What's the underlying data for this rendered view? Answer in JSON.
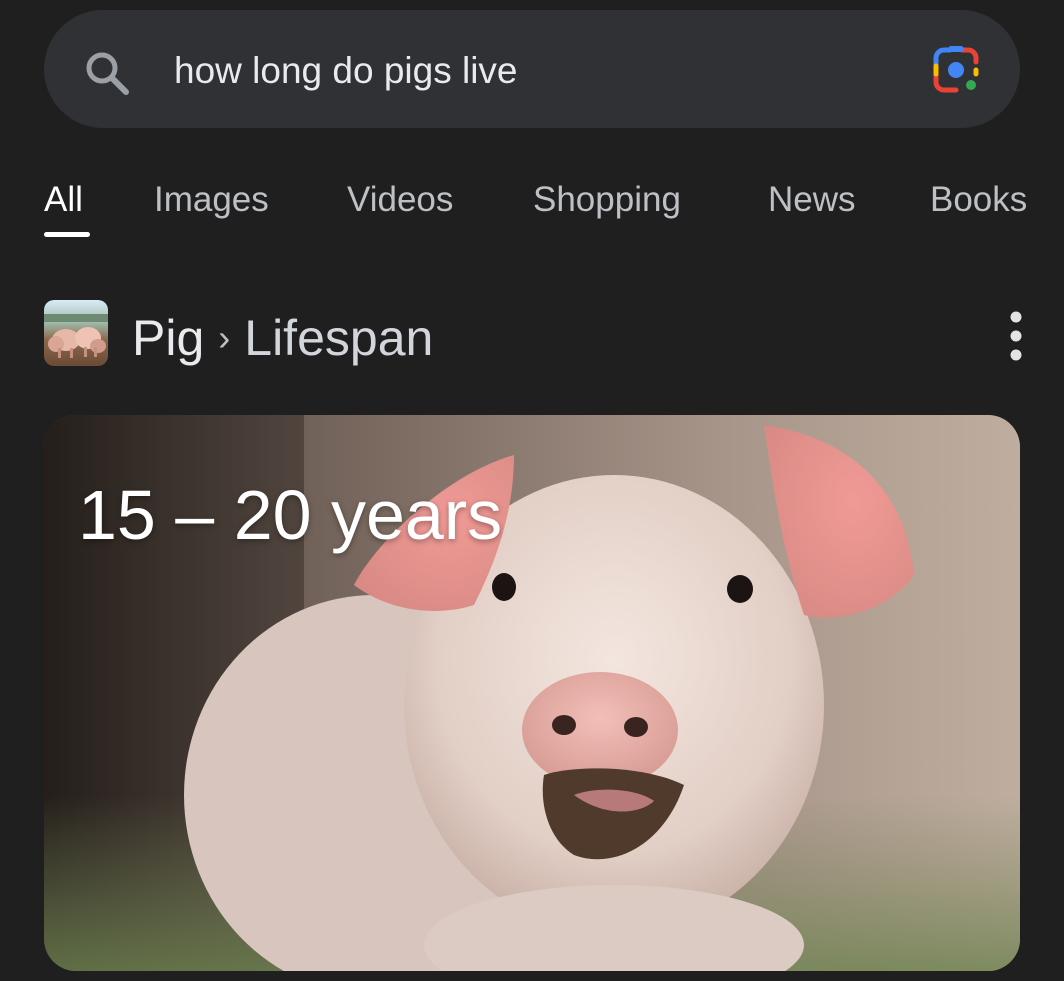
{
  "search": {
    "query": "how long do pigs live",
    "icons": {
      "left": "search-icon",
      "right": "google-lens-icon"
    }
  },
  "tabs": [
    {
      "label": "All",
      "active": true
    },
    {
      "label": "Images",
      "active": false
    },
    {
      "label": "Videos",
      "active": false
    },
    {
      "label": "Shopping",
      "active": false
    },
    {
      "label": "News",
      "active": false
    },
    {
      "label": "Books",
      "active": false
    }
  ],
  "result": {
    "topic": "Pig",
    "attribute": "Lifespan",
    "separator": "›",
    "answer": "15 – 20 years",
    "thumbnail": "pig-thumbnail",
    "menu_icon": "more-vert-icon"
  },
  "colors": {
    "background": "#1f1f1f",
    "search_bar": "#303134",
    "lens_blue": "#4285f4",
    "lens_red": "#ea4335",
    "lens_yellow": "#fbbc04",
    "lens_green": "#34a853"
  }
}
